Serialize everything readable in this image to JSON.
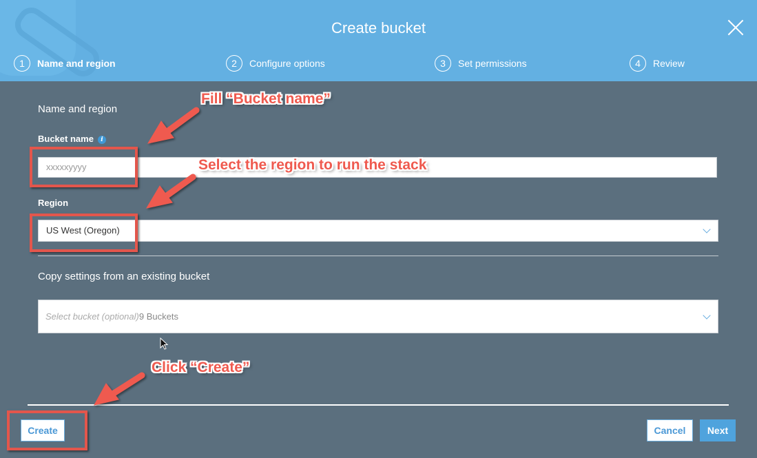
{
  "dialog": {
    "title": "Create bucket",
    "close_icon": "close-icon"
  },
  "steps": [
    {
      "number": "1",
      "label": "Name and region",
      "active": true
    },
    {
      "number": "2",
      "label": "Configure options",
      "active": false
    },
    {
      "number": "3",
      "label": "Set permissions",
      "active": false
    },
    {
      "number": "4",
      "label": "Review",
      "active": false
    }
  ],
  "form": {
    "section_title": "Name and region",
    "bucket_name": {
      "label": "Bucket name",
      "info_icon": "i",
      "value": "xxxxxyyyy"
    },
    "region": {
      "label": "Region",
      "value": "US West (Oregon)"
    },
    "copy_settings": {
      "title": "Copy settings from an existing bucket",
      "placeholder": "Select bucket (optional)",
      "count": "9 Buckets"
    }
  },
  "footer": {
    "create_label": "Create",
    "cancel_label": "Cancel",
    "next_label": "Next"
  },
  "annotations": {
    "fill_bucket_name": "Fill “Bucket name”",
    "select_region": "Select the region to run the stack",
    "click_create": "Click “Create”",
    "color": "#e3564c"
  }
}
